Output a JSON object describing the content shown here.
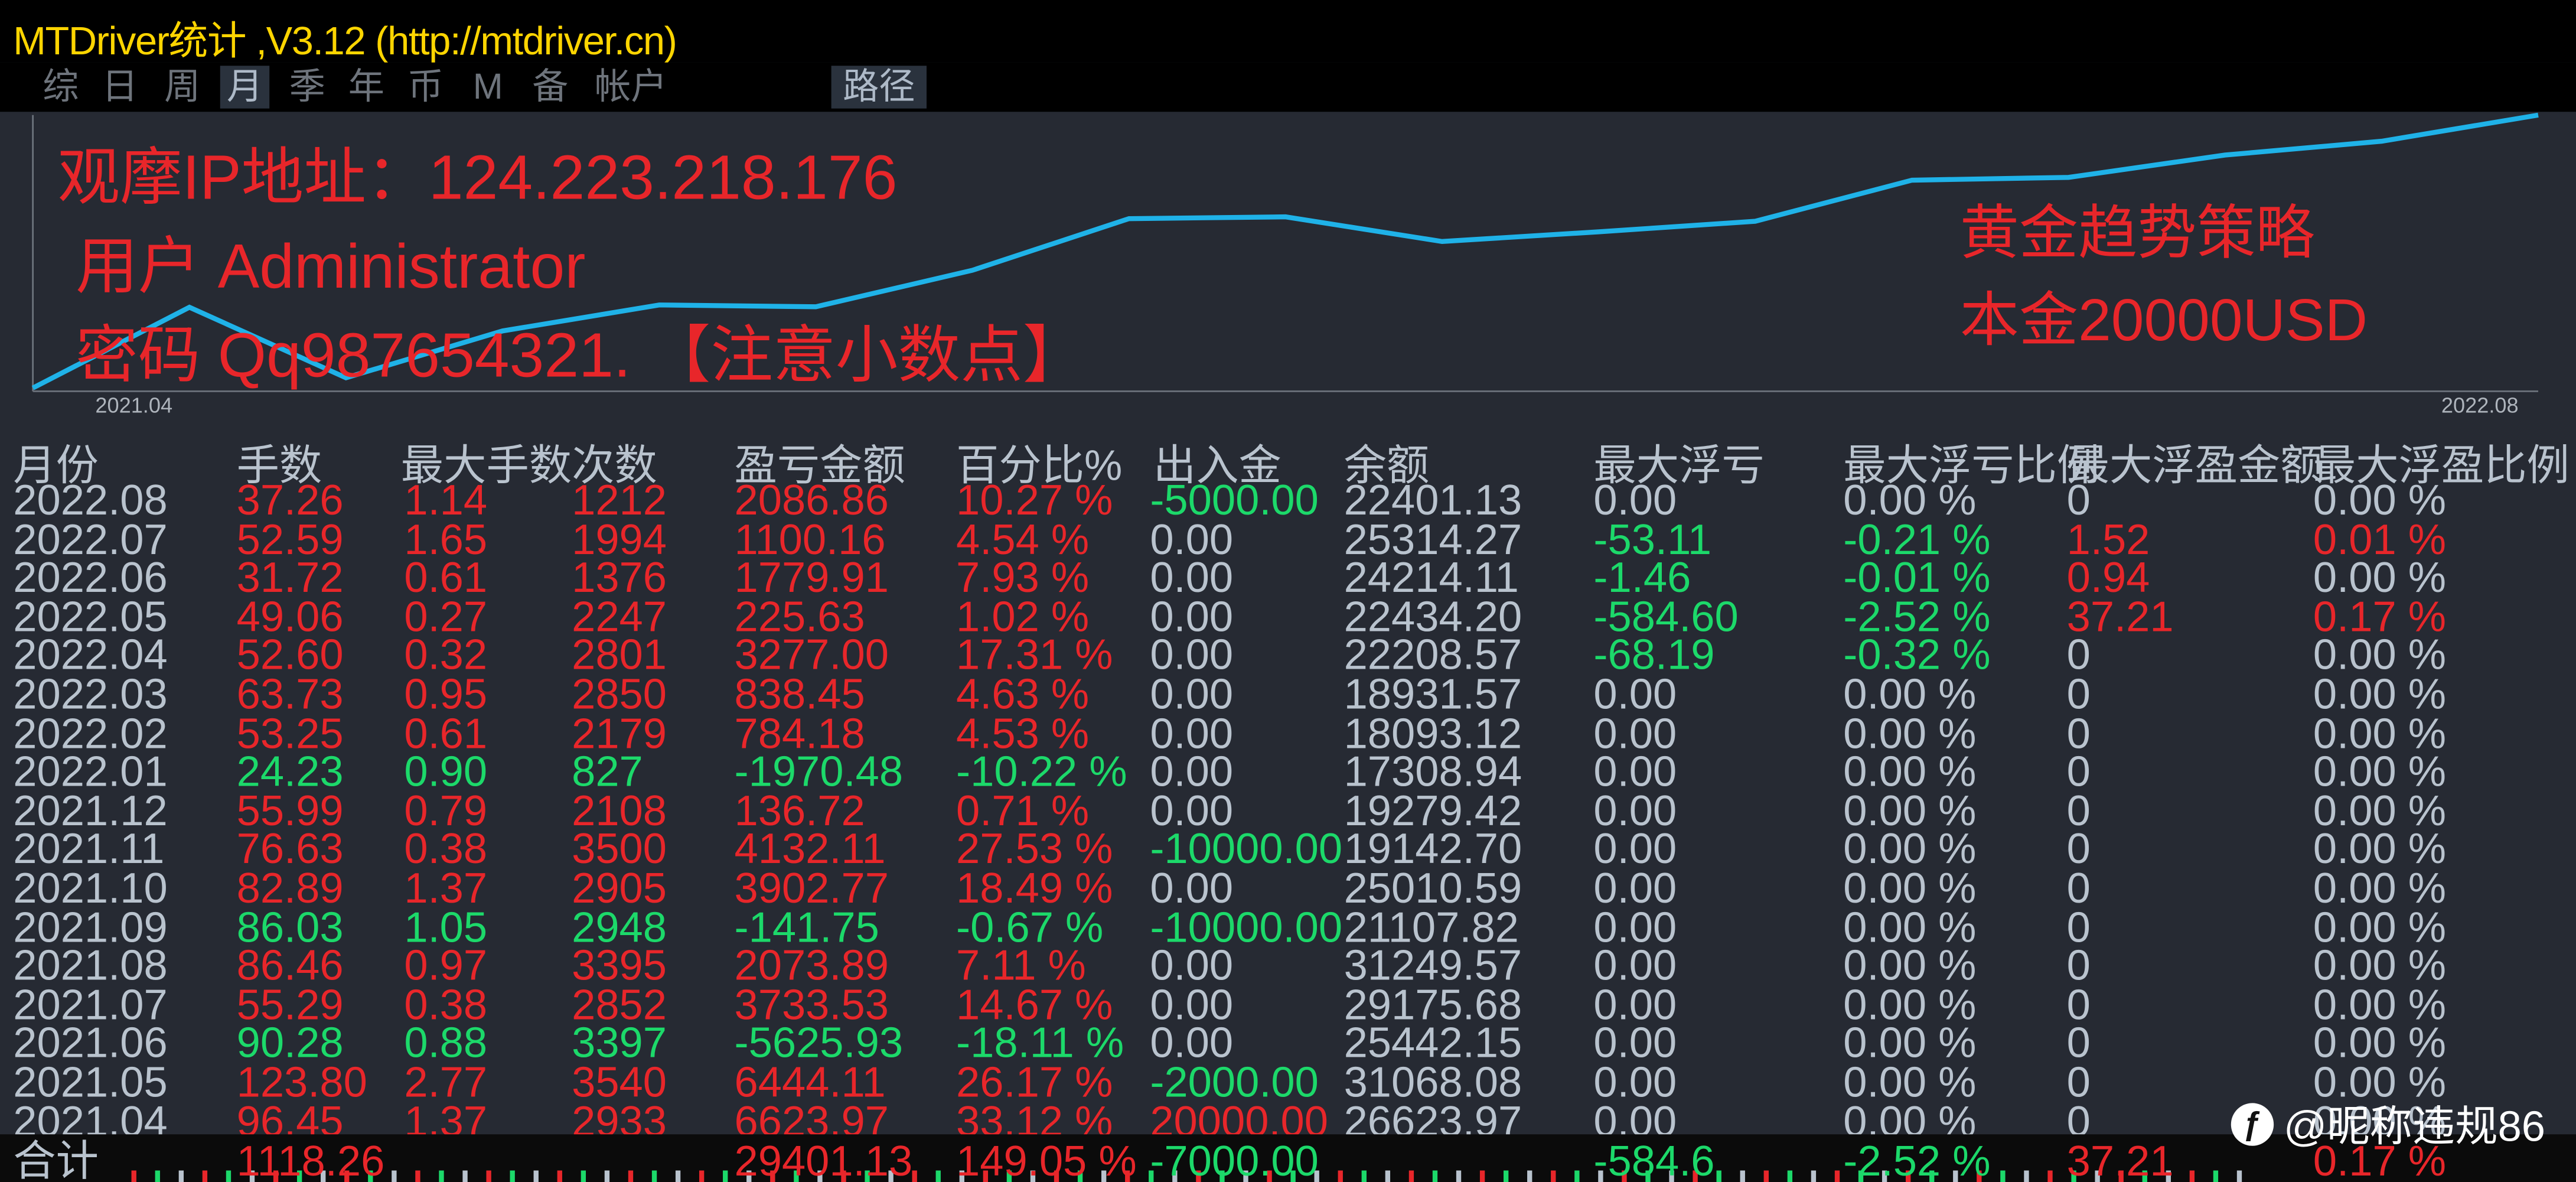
{
  "window": {
    "title": "MTDriver统计 ,V3.12 (http://mtdriver.cn)"
  },
  "toolbar": {
    "buttons": [
      "综",
      "日",
      "周",
      "月",
      "季",
      "年",
      "币",
      "M",
      "备",
      "帐户"
    ],
    "active": "月",
    "path_label": "路径"
  },
  "chart_overlay": {
    "ip_line": "观摩IP地址：124.223.218.176",
    "user_line": "用户 Administrator",
    "password_line": "密码 Qq987654321. 【注意小数点】",
    "strategy_line": "黄金趋势策略",
    "capital_line": "本金20000USD"
  },
  "chart_data": {
    "type": "line",
    "x_start_label": "2021.04",
    "x_end_label": "2022.08",
    "categories": [
      "2021.04",
      "2021.05",
      "2021.06",
      "2021.07",
      "2021.08",
      "2021.09",
      "2021.10",
      "2021.11",
      "2021.12",
      "2022.01",
      "2022.02",
      "2022.03",
      "2022.04",
      "2022.05",
      "2022.06",
      "2022.07",
      "2022.08"
    ],
    "series": [
      {
        "color": "#1fb2e8",
        "values": [
          6623.97,
          13068.08,
          7442.15,
          11175.68,
          13249.57,
          13107.82,
          16010.59,
          20142.7,
          20279.49,
          18308.94,
          19093.12,
          19931.57,
          23208.57,
          23434.2,
          25214.11,
          26314.27,
          28401.13
        ]
      }
    ],
    "grid": false
  },
  "table": {
    "headers": [
      "月份",
      "手数",
      "最大手数",
      "次数",
      "盈亏金额",
      "百分比%",
      "出入金",
      "余额",
      "最大浮亏",
      "最大浮亏比例",
      "最大浮盈金额",
      "最大浮盈比例"
    ],
    "rows": [
      [
        "2022.08",
        "37.26",
        "1.14",
        "1212",
        "2086.86",
        "10.27 %",
        "-5000.00",
        "22401.13",
        "0.00",
        "0.00 %",
        "0",
        "0.00 %"
      ],
      [
        "2022.07",
        "52.59",
        "1.65",
        "1994",
        "1100.16",
        "4.54 %",
        "0.00",
        "25314.27",
        "-53.11",
        "-0.21 %",
        "1.52",
        "0.01 %"
      ],
      [
        "2022.06",
        "31.72",
        "0.61",
        "1376",
        "1779.91",
        "7.93 %",
        "0.00",
        "24214.11",
        "-1.46",
        "-0.01 %",
        "0.94",
        "0.00 %"
      ],
      [
        "2022.05",
        "49.06",
        "0.27",
        "2247",
        "225.63",
        "1.02 %",
        "0.00",
        "22434.20",
        "-584.60",
        "-2.52 %",
        "37.21",
        "0.17 %"
      ],
      [
        "2022.04",
        "52.60",
        "0.32",
        "2801",
        "3277.00",
        "17.31 %",
        "0.00",
        "22208.57",
        "-68.19",
        "-0.32 %",
        "0",
        "0.00 %"
      ],
      [
        "2022.03",
        "63.73",
        "0.95",
        "2850",
        "838.45",
        "4.63 %",
        "0.00",
        "18931.57",
        "0.00",
        "0.00 %",
        "0",
        "0.00 %"
      ],
      [
        "2022.02",
        "53.25",
        "0.61",
        "2179",
        "784.18",
        "4.53 %",
        "0.00",
        "18093.12",
        "0.00",
        "0.00 %",
        "0",
        "0.00 %"
      ],
      [
        "2022.01",
        "24.23",
        "0.90",
        "827",
        "-1970.48",
        "-10.22 %",
        "0.00",
        "17308.94",
        "0.00",
        "0.00 %",
        "0",
        "0.00 %"
      ],
      [
        "2021.12",
        "55.99",
        "0.79",
        "2108",
        "136.72",
        "0.71 %",
        "0.00",
        "19279.42",
        "0.00",
        "0.00 %",
        "0",
        "0.00 %"
      ],
      [
        "2021.11",
        "76.63",
        "0.38",
        "3500",
        "4132.11",
        "27.53 %",
        "-10000.00",
        "19142.70",
        "0.00",
        "0.00 %",
        "0",
        "0.00 %"
      ],
      [
        "2021.10",
        "82.89",
        "1.37",
        "2905",
        "3902.77",
        "18.49 %",
        "0.00",
        "25010.59",
        "0.00",
        "0.00 %",
        "0",
        "0.00 %"
      ],
      [
        "2021.09",
        "86.03",
        "1.05",
        "2948",
        "-141.75",
        "-0.67 %",
        "-10000.00",
        "21107.82",
        "0.00",
        "0.00 %",
        "0",
        "0.00 %"
      ],
      [
        "2021.08",
        "86.46",
        "0.97",
        "3395",
        "2073.89",
        "7.11 %",
        "0.00",
        "31249.57",
        "0.00",
        "0.00 %",
        "0",
        "0.00 %"
      ],
      [
        "2021.07",
        "55.29",
        "0.38",
        "2852",
        "3733.53",
        "14.67 %",
        "0.00",
        "29175.68",
        "0.00",
        "0.00 %",
        "0",
        "0.00 %"
      ],
      [
        "2021.06",
        "90.28",
        "0.88",
        "3397",
        "-5625.93",
        "-18.11 %",
        "0.00",
        "25442.15",
        "0.00",
        "0.00 %",
        "0",
        "0.00 %"
      ],
      [
        "2021.05",
        "123.80",
        "2.77",
        "3540",
        "6444.11",
        "26.17 %",
        "-2000.00",
        "31068.08",
        "0.00",
        "0.00 %",
        "0",
        "0.00 %"
      ],
      [
        "2021.04",
        "96.45",
        "1.37",
        "2933",
        "6623.97",
        "33.12 %",
        "20000.00",
        "26623.97",
        "0.00",
        "0.00 %",
        "0",
        "0.00 %"
      ]
    ],
    "total": [
      "合计",
      "1118.26",
      "",
      "",
      "29401.13",
      "149.05 %",
      "-7000.00",
      "",
      "-584.6",
      "-2.52 %",
      "37.21",
      "0.17 %"
    ]
  },
  "watermark": {
    "icon": "weibo-icon",
    "text": "@昵称违规86"
  },
  "colors": {
    "profit": "#e8262a",
    "loss": "#1cd96a",
    "neutral": "#b9c3ce",
    "title": "#ffd500",
    "curve": "#1fb2e8",
    "background": "#262a33"
  }
}
